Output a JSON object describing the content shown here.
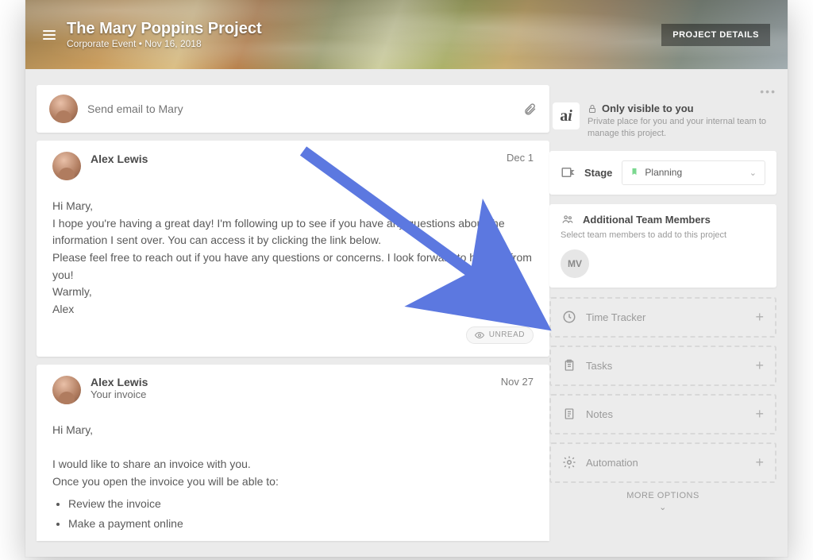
{
  "hero": {
    "title": "The Mary Poppins Project",
    "subtitle": "Corporate Event • Nov 16, 2018",
    "project_details_btn": "PROJECT DETAILS"
  },
  "compose": {
    "placeholder": "Send email to Mary"
  },
  "messages": [
    {
      "author": "Alex Lewis",
      "date": "Dec 1",
      "body_html": "Hi Mary,<br>I hope you're having a great day! I'm following up to see if you have any questions about the information I sent over. You can access it by clicking the link below.<br>Please feel free to reach out if you have any questions or concerns. I look forward to hearing from you!<br>Warmly,<br>Alex",
      "unread_label": "UNREAD"
    },
    {
      "author": "Alex Lewis",
      "subtitle": "Your invoice",
      "date": "Nov 27",
      "body_html": "Hi Mary,<br><br>I would like to share an invoice with you.<br>Once you open the invoice you will be able to:<ul><li>Review the invoice</li><li>Make a payment online</li></ul>"
    }
  ],
  "sidebar": {
    "visibility": {
      "title": "Only visible to you",
      "sub": "Private place for you and your internal team to manage this project.",
      "avatar_text": "a"
    },
    "stage": {
      "label": "Stage",
      "value": "Planning"
    },
    "team": {
      "title": "Additional Team Members",
      "sub": "Select team members to add to this project",
      "members": [
        "MV"
      ]
    },
    "tools": [
      {
        "label": "Time Tracker",
        "icon": "clock"
      },
      {
        "label": "Tasks",
        "icon": "clipboard"
      },
      {
        "label": "Notes",
        "icon": "note"
      },
      {
        "label": "Automation",
        "icon": "gear"
      }
    ],
    "more_options": "MORE OPTIONS"
  },
  "annotation": {
    "arrow_color": "#5c78e0"
  }
}
